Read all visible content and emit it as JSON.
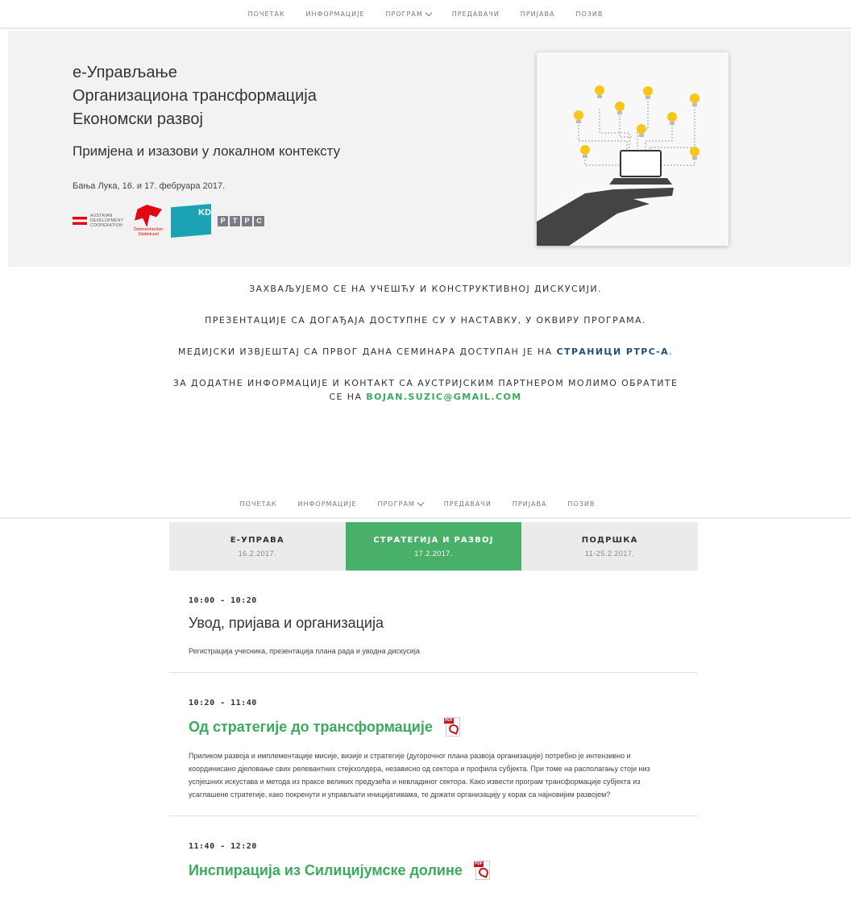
{
  "nav": {
    "items": [
      "ПОЧЕТАК",
      "ИНФОРМАЦИЈЕ",
      "ПРОГРАМ",
      "ПРЕДАВАЧИ",
      "ПРИЈАВА",
      "ПОЗИВ"
    ]
  },
  "hero": {
    "title_lines": [
      "е-Управљање",
      "Организациона трансформација",
      "Економски развој"
    ],
    "subtitle": "Примјена и изазови у локалном контексту",
    "date": "Бања Лука, 16. и 17. фебруара 2017.",
    "logos": {
      "ada": "AUSTRIAN DEVELOPMENT COOPERATION",
      "osb": "Österreichischer Städtebund",
      "kdz": "KDZ",
      "rtrs": [
        "Р",
        "Т",
        "Р",
        "С"
      ]
    }
  },
  "message": {
    "line1": "ЗАХВАЉУЈЕМО СЕ НА УЧЕШЋУ И КОНСТРУКТИВНОЈ ДИСКУСИЈИ.",
    "line2": "ПРЕЗЕНТАЦИЈЕ СА ДОГАЂАЈА ДОСТУПНЕ СУ У НАСТАВКУ, У ОКВИРУ ПРОГРАМА.",
    "line3_text": "МЕДИЈСКИ ИЗВЈЕШТАЈ СА ПРВОГ ДАНА СЕМИНАРА ДОСТУПАН ЈЕ НА ",
    "line3_link": "СТРАНИЦИ РТРС-А",
    "line3_end": ".",
    "line4_text": "ЗА ДОДАТНЕ ИНФОРМАЦИЈЕ И КОНТАКТ СА АУСТРИЈСКИМ ПАРТНЕРОМ МОЛИМО ОБРАТИТЕ СЕ НА ",
    "line4_link": "BOJAN.SUZIC@GMAIL.COM"
  },
  "tabs": [
    {
      "label": "Е-УПРАВА",
      "date": "16.2.2017."
    },
    {
      "label": "СТРАТЕГИЈА И РАЗВОЈ",
      "date": "17.2.2017."
    },
    {
      "label": "ПОДРШКА",
      "date": "11-25.2.2017."
    }
  ],
  "sessions": [
    {
      "time": "10:00 - 10:20",
      "title": "Увод, пријава и организација",
      "desc": "Регистрација учесника, презентација плана рада и уводна дискусија"
    },
    {
      "time": "10:20 - 11:40",
      "title": "Од стратегије до трансформације",
      "desc": "Приликом развоја и имплементације мисије, визије и стратегије (дугорочног плана развоја организације) потребно је интензивно и координисано дјеловање свих релевантних стејкхолдера, независно од сектора и профила субјекта. При томе на располагању стоји низ успјешних искустава и метода из праксе великих предузећа и невладиног сектора. Како извести програм трансформације субјекта из усаглашене стратегије, како покренути и управљати иницијативама, те држати организацију у корак са најновијим развојем?"
    },
    {
      "time": "11:40 - 12:20",
      "title": "Инспирација из Силицијумске долине"
    }
  ],
  "colors": {
    "accent_green": "#49b06a",
    "link_blue": "#1f4e79",
    "pdf_red": "#c5161d"
  }
}
